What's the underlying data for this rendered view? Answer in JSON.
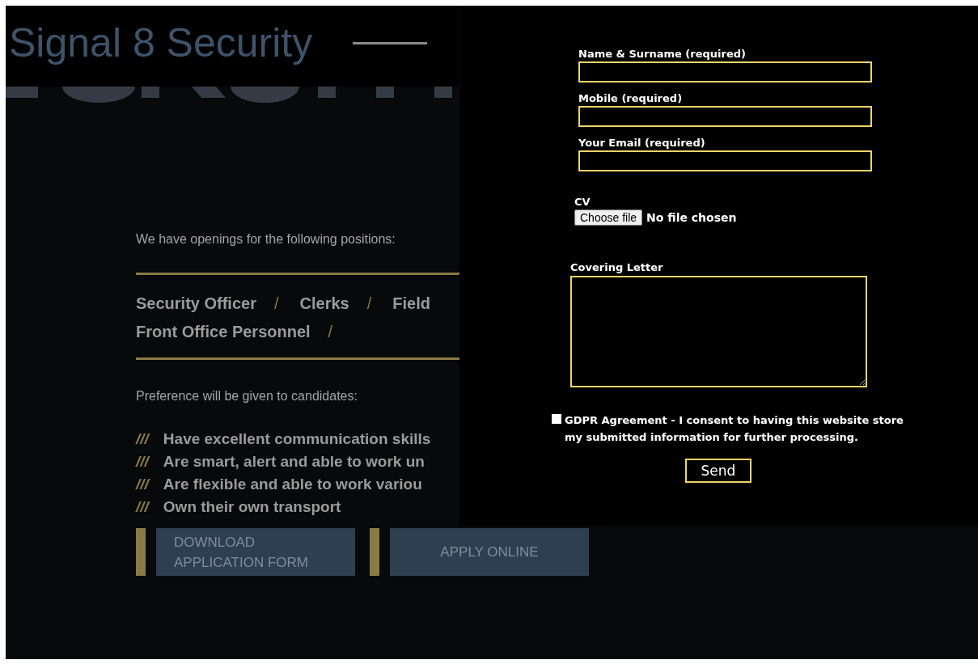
{
  "header": {
    "title": "Signal 8 Security"
  },
  "intro": "We have openings for the following positions:",
  "positions": [
    {
      "name": "Security Officer",
      "separator": "/"
    },
    {
      "name": "Clerks",
      "separator": "/"
    },
    {
      "name": "Field"
    },
    {
      "name": "Front Office Personnel",
      "separator": "/"
    }
  ],
  "preference": "Preference will be given to candidates:",
  "requirements": [
    {
      "marker": "///",
      "text": "Have excellent communication skills"
    },
    {
      "marker": "///",
      "text": "Are smart, alert and able to work un"
    },
    {
      "marker": "///",
      "text": "Are flexible and able to work variou"
    },
    {
      "marker": "///",
      "text": "Own their own transport"
    }
  ],
  "actions": [
    {
      "label": "DOWNLOAD\nAPPLICATION FORM"
    },
    {
      "label": "APPLY ONLINE"
    }
  ],
  "form": {
    "fields": [
      {
        "kind": "text",
        "label": "Name & Surname (required)"
      },
      {
        "kind": "text",
        "label": "Mobile (required)"
      },
      {
        "kind": "text",
        "label": "Your Email (required)"
      },
      {
        "kind": "file",
        "label": "CV",
        "button": "Choose file",
        "status": "No file chosen"
      },
      {
        "kind": "textarea",
        "label": "Covering Letter"
      }
    ],
    "consent": {
      "checked": false,
      "text": "GDPR Agreement - I consent to having this website store my submitted information for further processing."
    },
    "submit": "Send"
  }
}
